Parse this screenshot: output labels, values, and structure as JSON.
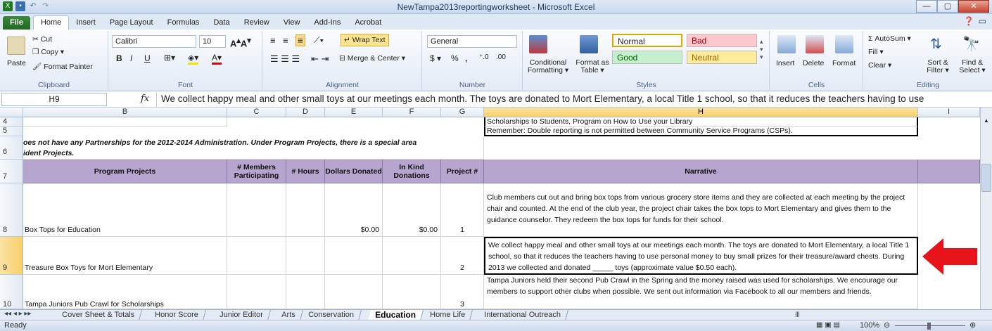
{
  "window": {
    "title": "NewTampa2013reportingworksheet - Microsoft Excel",
    "minimize": "—",
    "maximize": "▢",
    "close": "✕"
  },
  "tabs": [
    "File",
    "Home",
    "Insert",
    "Page Layout",
    "Formulas",
    "Data",
    "Review",
    "View",
    "Add-Ins",
    "Acrobat"
  ],
  "ribbon": {
    "clipboard": {
      "label": "Clipboard",
      "paste": "Paste",
      "cut": "Cut",
      "copy": "Copy ▾",
      "format_painter": "Format Painter"
    },
    "font": {
      "label": "Font",
      "name": "Calibri",
      "size": "10",
      "bold": "B",
      "italic": "I",
      "underline": "U"
    },
    "alignment": {
      "label": "Alignment",
      "wrap_text": "Wrap Text",
      "merge": "Merge & Center ▾"
    },
    "number": {
      "label": "Number",
      "format": "General",
      "currency": "$ ▾",
      "percent": "%",
      "comma": ","
    },
    "styles": {
      "label": "Styles",
      "conditional": "Conditional Formatting ▾",
      "format_table": "Format as Table ▾",
      "normal": "Normal",
      "bad": "Bad",
      "good": "Good",
      "neutral": "Neutral"
    },
    "cells": {
      "label": "Cells",
      "insert": "Insert",
      "delete": "Delete",
      "format": "Format"
    },
    "editing": {
      "label": "Editing",
      "autosum": "Σ AutoSum ▾",
      "fill": "Fill ▾",
      "clear": "Clear ▾",
      "sort": "Sort & Filter ▾",
      "find": "Find & Select ▾"
    }
  },
  "formula_bar": {
    "name_box": "H9",
    "fx": "fx",
    "content": "We collect happy meal and other small toys at our meetings each month.  The toys are donated to Mort Elementary, a local Title 1 school, so that it reduces the teachers having to use"
  },
  "columns": [
    "B",
    "C",
    "D",
    "E",
    "F",
    "G",
    "H",
    "I"
  ],
  "rows": {
    "r4": {
      "num": "4",
      "h": "Scholarships to Students, Program on How to Use your Library"
    },
    "r5": {
      "num": "5",
      "h": "Remember: Double reporting is not permitted between Community Service Programs (CSPs)."
    },
    "r6": {
      "num": "6",
      "b1": "oes not have any Partnerships for the 2012-2014 Administration. Under Program Projects, there is a special area",
      "b2": "ident Projects."
    },
    "r7": {
      "num": "7",
      "b": "Program Projects",
      "c": "# Members Participating",
      "d": "# Hours",
      "e": "Dollars Donated",
      "f": "In Kind Donations",
      "g": "Project #",
      "h": "Narrative"
    },
    "r8": {
      "num": "8",
      "b": "Box Tops for Education",
      "e": "$0.00",
      "f": "$0.00",
      "g": "1",
      "h": "Club members cut out and bring box tops from various grocery store items and they are collected at each meeting by the project chair and counted.  At the end of the club year, the project chair takes the box tops to Mort Elementary and gives them to the guidance counselor.  They redeem the box tops for funds for their school."
    },
    "r9": {
      "num": "9",
      "b": "Treasure Box Toys for Mort Elementary",
      "g": "2",
      "h": "We collect happy meal and other small toys at our meetings each month.  The toys are donated to Mort Elementary, a local Title 1 school, so that it reduces the teachers having to use personal money to buy small prizes for their treasure/award chests.  During 2013 we collected and donated _____ toys (approximate value $0.50 each)."
    },
    "r10": {
      "num": "10",
      "b": "Tampa Juniors Pub Crawl for Scholarships",
      "g": "3",
      "h": "Tampa Juniors held their second Pub Crawl in the Spring and the money raised was used for scholarships.  We encourage our members to support other clubs when possible.  We sent out information via Facebook to all our members and friends."
    }
  },
  "sheet_tabs": [
    "Cover Sheet & Totals",
    "Honor Score",
    "Junior Editor",
    "Arts",
    "Conservation",
    "Education",
    "Home Life",
    "International Outreach"
  ],
  "status": {
    "ready": "Ready",
    "zoom": "100%"
  },
  "colors": {
    "header_fill": "#b6a5cf",
    "selected_col": "#f8cf6a",
    "arrow": "#e8141b"
  }
}
